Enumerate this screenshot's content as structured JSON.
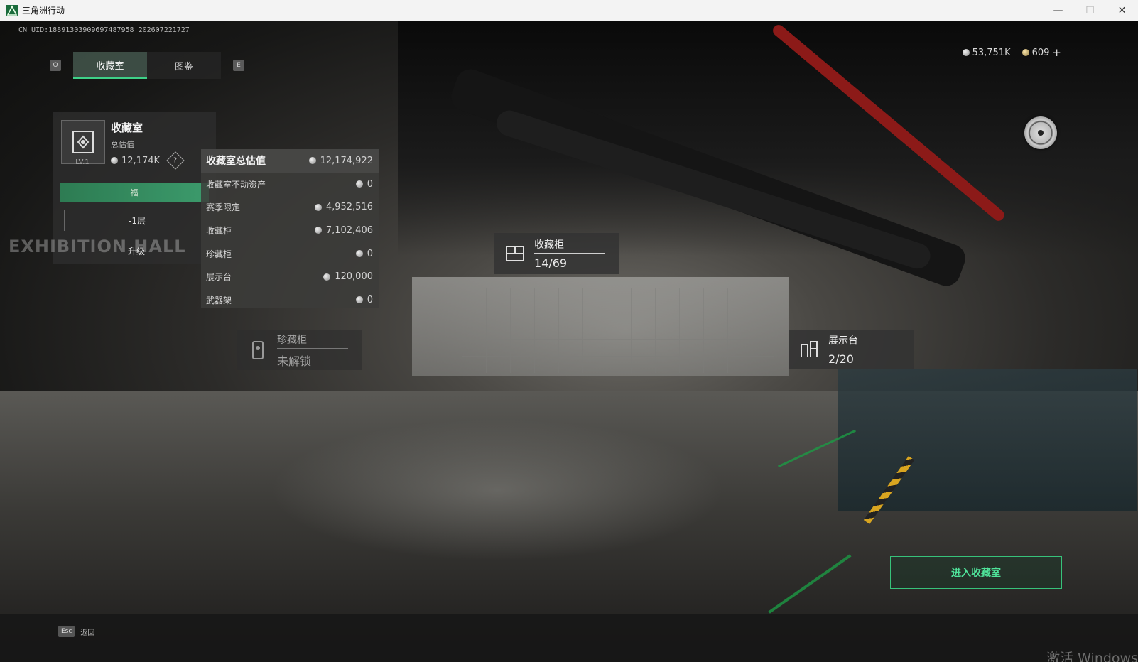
{
  "window": {
    "title": "三角洲行动",
    "minimize": "—",
    "maximize": "☐",
    "close": "✕"
  },
  "hud": {
    "uid": "CN UID:18891303909697487958 202607221727",
    "currency_silver": "53,751K",
    "currency_gold": "609",
    "add": "+"
  },
  "tabs": {
    "key_left": "Q",
    "key_right": "E",
    "items": [
      {
        "label": "收藏室",
        "active": true
      },
      {
        "label": "图鉴",
        "active": false
      }
    ]
  },
  "room_card": {
    "title": "收藏室",
    "subtitle": "总估值",
    "value": "12,174K",
    "help": "?",
    "level": "LV.1",
    "green_label": "福",
    "floor": "-1层",
    "upgrade": "升级",
    "sign": "EXHIBITION HALL"
  },
  "valuation": {
    "title": "收藏室总估值",
    "total": "12,174,922",
    "rows": [
      {
        "label": "收藏室不动资产",
        "value": "0"
      },
      {
        "label": "赛季限定",
        "value": "4,952,516"
      },
      {
        "label": "收藏柜",
        "value": "7,102,406"
      },
      {
        "label": "珍藏柜",
        "value": "0"
      },
      {
        "label": "展示台",
        "value": "120,000"
      },
      {
        "label": "武器架",
        "value": "0"
      }
    ]
  },
  "scene_labels": {
    "cabinet": {
      "name": "收藏柜",
      "count": "14/69"
    },
    "treasure": {
      "name": "珍藏柜",
      "count": "未解锁"
    },
    "display": {
      "name": "展示台",
      "count": "2/20"
    }
  },
  "enter_button": "进入收藏室",
  "bottom": {
    "esc_key": "Esc",
    "back": "返回",
    "watermark": "激活 Windows"
  },
  "colors": {
    "accent": "#3ed188",
    "enter_text": "#4fe39a"
  }
}
